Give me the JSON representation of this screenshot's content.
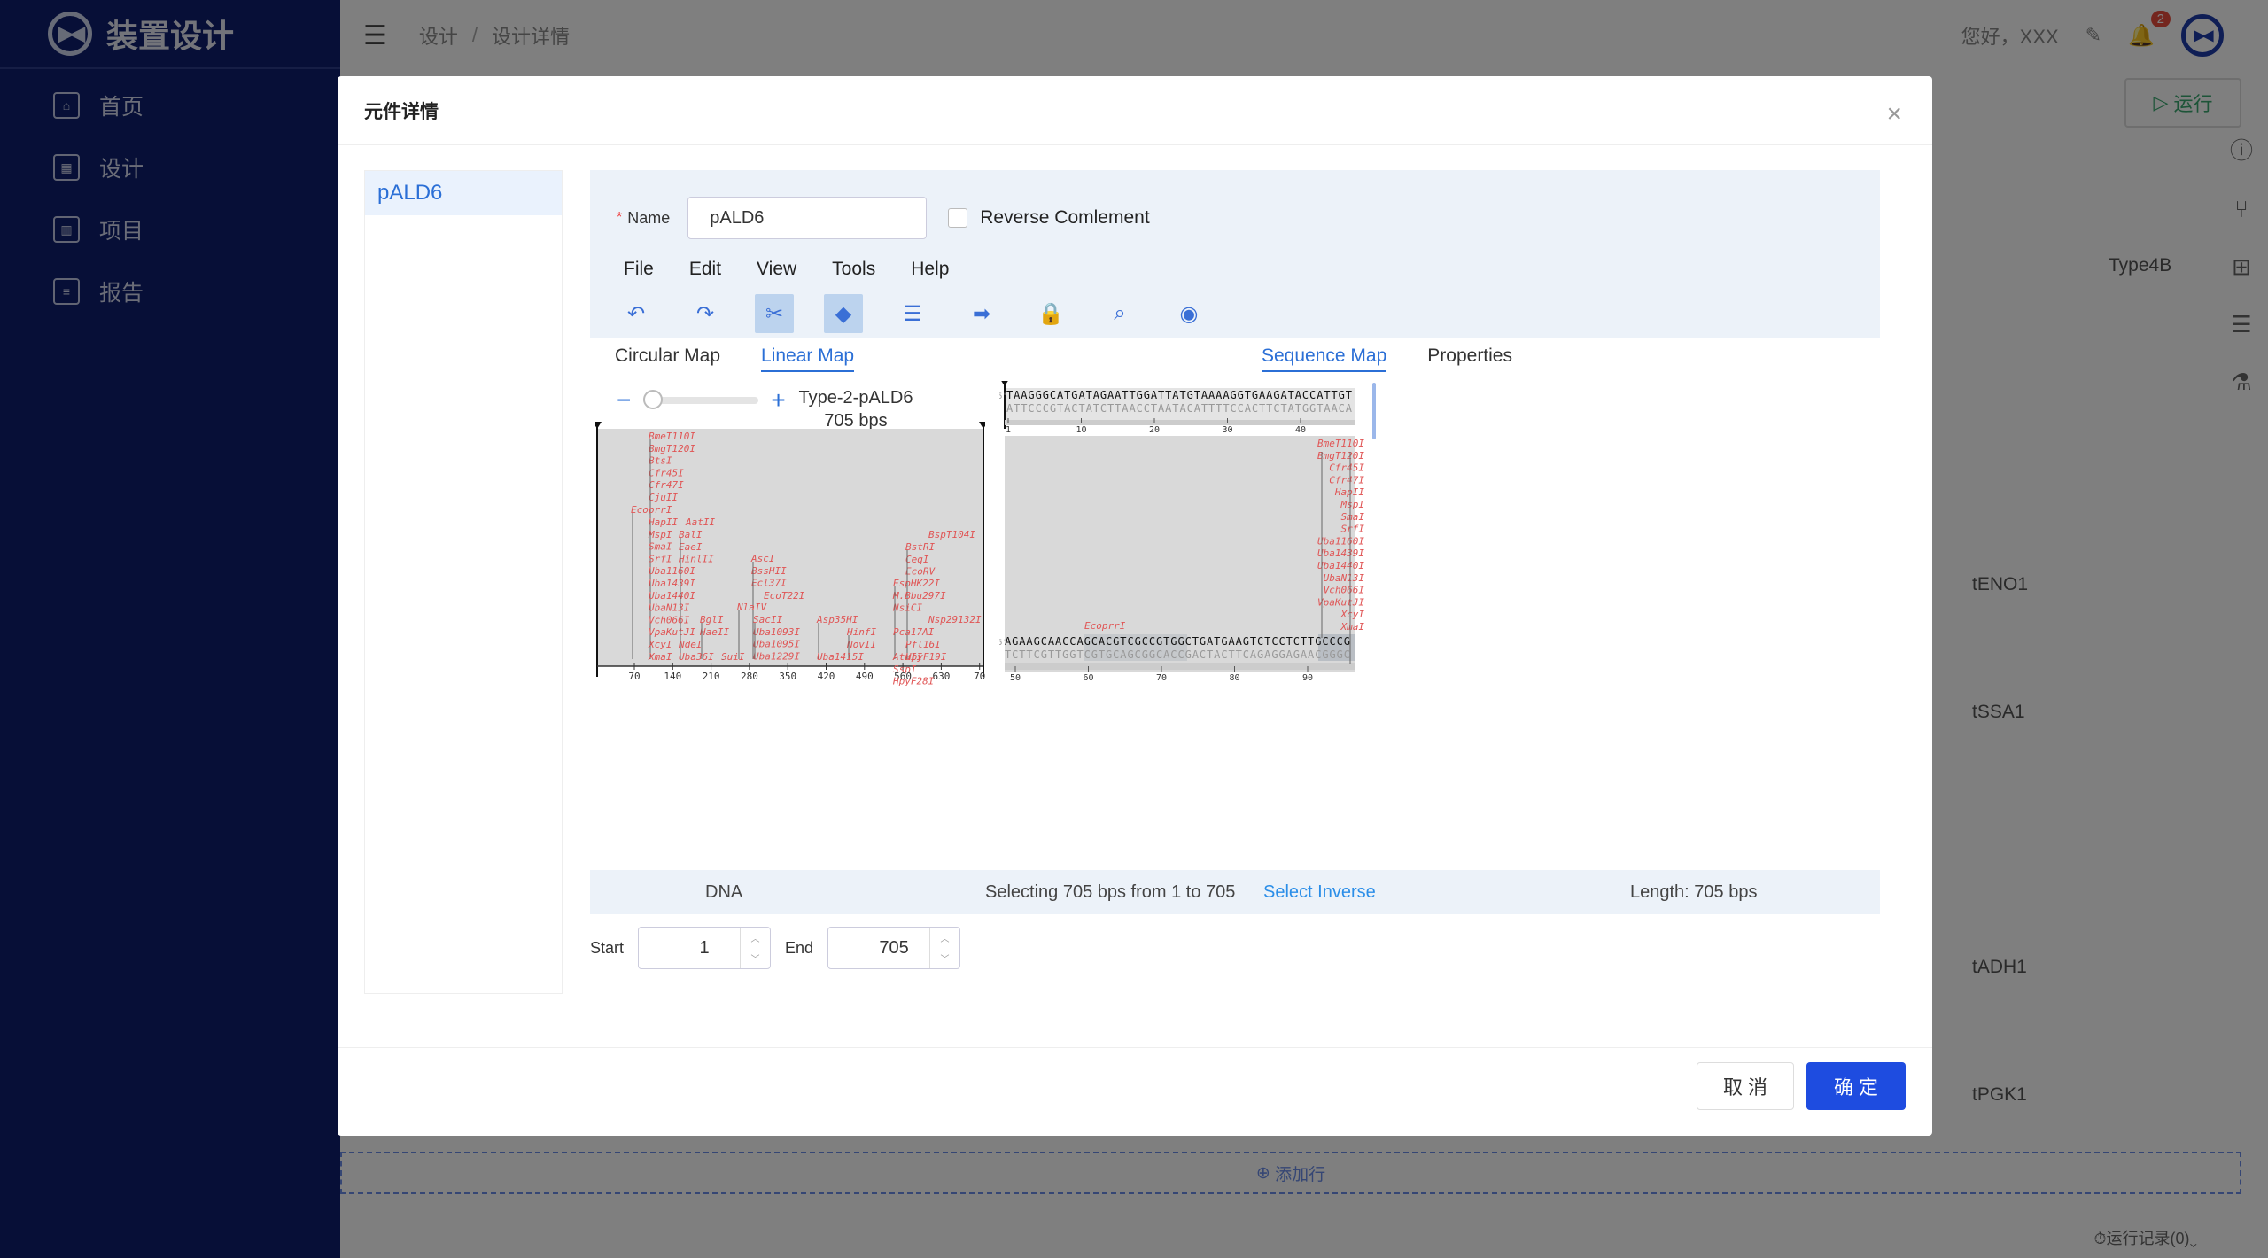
{
  "app": {
    "title": "装置设计"
  },
  "nav": [
    {
      "label": "首页",
      "icon": "home-icon"
    },
    {
      "label": "设计",
      "icon": "design-icon"
    },
    {
      "label": "项目",
      "icon": "project-icon"
    },
    {
      "label": "报告",
      "icon": "report-icon"
    }
  ],
  "breadcrumb": {
    "part1": "设计",
    "sep": "/",
    "part2": "设计详情"
  },
  "topbar": {
    "greeting": "您好，XXX",
    "badge_count": "2"
  },
  "background": {
    "run_label": "运行",
    "type_label": "Type4B",
    "rows": [
      "tENO1",
      "tSSA1",
      "tADH1",
      "tPGK1"
    ],
    "add_row": "添加行",
    "run_log": "运行记录(0)"
  },
  "modal": {
    "title": "元件详情",
    "list_item": "pALD6",
    "name_label": "Name",
    "name_value": "pALD6",
    "reverse_label": "Reverse Comlement",
    "menus": [
      "File",
      "Edit",
      "View",
      "Tools",
      "Help"
    ],
    "tab_circular": "Circular Map",
    "tab_linear": "Linear Map",
    "tab_sequence": "Sequence Map",
    "tab_properties": "Properties",
    "seq_name": "Type-2-pALD6",
    "seq_length": "705 bps",
    "status_type": "DNA",
    "status_selection": "Selecting 705 bps from 1 to 705",
    "status_inverse": "Select Inverse",
    "status_length": "Length: 705 bps",
    "start_label": "Start",
    "start_value": "1",
    "end_label": "End",
    "end_value": "705",
    "cancel": "取 消",
    "confirm": "确 定"
  },
  "linear_map": {
    "ticks": [
      "70",
      "140",
      "210",
      "280",
      "350",
      "420",
      "490",
      "560",
      "630",
      "70"
    ],
    "enzymes_a": [
      "BmeT110I",
      "BmgT120I",
      "BtsI",
      "Cfr45I",
      "Cfr47I",
      "CjuII",
      "EcoprrI",
      "HapII",
      "MspI",
      "SmaI",
      "SrfI",
      "Uba1160I",
      "Uba1439I",
      "Uba1440I",
      "UbaN13I",
      "Vch066I",
      "VpaKutJI",
      "XcyI",
      "XmaI"
    ],
    "enzymes_b": [
      "AatII",
      "BalI",
      "EaeI",
      "HinlII",
      "BglI",
      "HaeII",
      "NdeI",
      "Uba36I",
      "SuiI"
    ],
    "enzymes_c": [
      "AscI",
      "BssHII",
      "Ecl37I",
      "EcoT22I",
      "NlaIV",
      "SacII",
      "Uba1093I",
      "Uba1095I",
      "Uba1229I"
    ],
    "enzymes_d": [
      "Asp35HI",
      "HinfI",
      "NovII",
      "Uba1415I"
    ],
    "enzymes_e": [
      "BspT104I",
      "BstRI",
      "CeqI",
      "EcoRV",
      "EspHK22I",
      "M.Bbu297I",
      "NsiCI",
      "Nsp29132I",
      "Pca17AI",
      "Pfl16I",
      "HpyF19I",
      "AtuII",
      "SspI",
      "HpyF28I"
    ]
  },
  "sequence_map": {
    "top_strand": "TAAGGGCATGATAGAATTGGATTATGTAAAAGGTGAAGATACCATTGT",
    "bottom_strand": "ATTCCCGTACTATCTTAACCTAATACATTTTCCACTTCTATGGTAACA",
    "ticks1": [
      "1",
      "10",
      "20",
      "30",
      "40"
    ],
    "top_strand2": "AGAAGCAACCAGCACGTCGCCGTGGCTGATGAAGTCTCCTCTTGCCCG",
    "bottom_strand2": "TCTTCGTTGGTCGTGCAGCGGCACCGACTACTTCAGAGGAGAACGGGC",
    "ticks2": [
      "50",
      "60",
      "70",
      "80",
      "90"
    ],
    "enzyme_mid": "EcoprrI",
    "enzymes_right": [
      "BmeT110I",
      "BmgT120I",
      "Cfr45I",
      "Cfr47I",
      "HapII",
      "MspI",
      "SmaI",
      "SrfI",
      "Uba1160I",
      "Uba1439I",
      "Uba1440I",
      "UbaN13I",
      "Vch066I",
      "VpaKutJI",
      "XcyI",
      "XmaI"
    ],
    "strand_5": "5'",
    "strand_3": "3'"
  }
}
